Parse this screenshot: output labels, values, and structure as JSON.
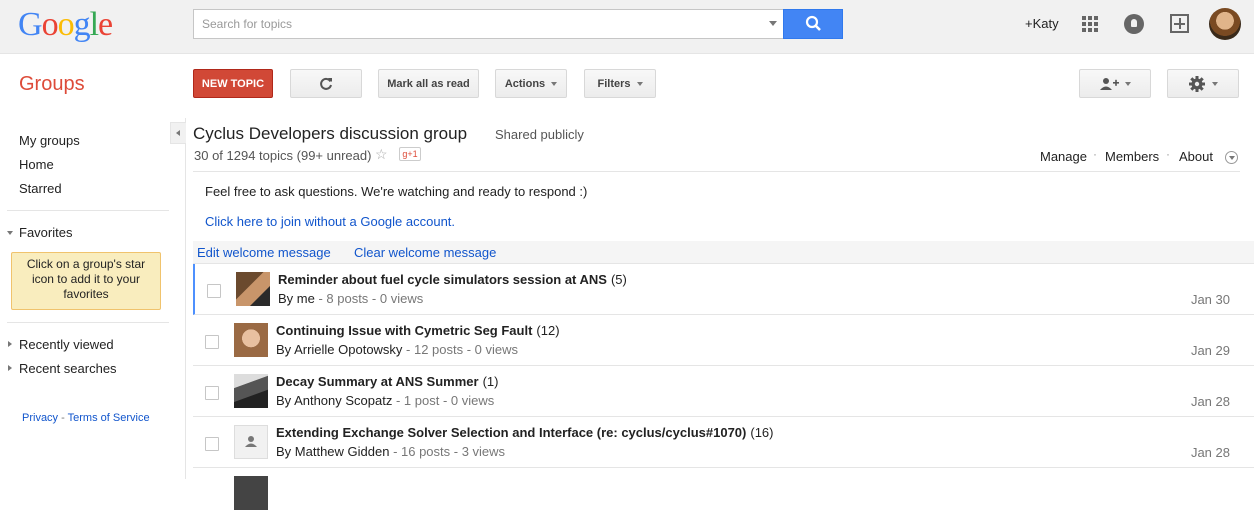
{
  "header": {
    "logo_letters": [
      "G",
      "o",
      "o",
      "g",
      "l",
      "e"
    ],
    "logo_colors": [
      "#4285f4",
      "#ea4335",
      "#fbbc05",
      "#4285f4",
      "#34a853",
      "#ea4335"
    ],
    "search_placeholder": "Search for topics",
    "user_link": "+Katy"
  },
  "toolbar": {
    "app_title": "Groups",
    "new_topic": "NEW TOPIC",
    "mark_all_read": "Mark all as read",
    "actions": "Actions",
    "filters": "Filters"
  },
  "sidebar": {
    "items": [
      "My groups",
      "Home",
      "Starred"
    ],
    "favorites_label": "Favorites",
    "favorites_hint": "Click on a group's star icon to add it to your favorites",
    "recently_viewed": "Recently viewed",
    "recent_searches": "Recent searches",
    "privacy": "Privacy",
    "terms": "Terms of Service"
  },
  "group": {
    "name": "Cyclus Developers discussion group",
    "visibility": "Shared publicly",
    "topic_count": "30 of 1294 topics (99+ unread)",
    "gplus": "g+1",
    "manage": "Manage",
    "members": "Members",
    "about": "About",
    "welcome_text": "Feel free to ask questions.  We're watching and ready to respond :)",
    "join_link": "Click here to join without a Google account.",
    "edit_welcome": "Edit welcome message",
    "clear_welcome": "Clear welcome message"
  },
  "topics": [
    {
      "title": "Reminder about fuel cycle simulators session at ANS",
      "count": "(5)",
      "by": "By me",
      "stats": " - 8 posts - 0 views",
      "date": "Jan 30"
    },
    {
      "title": "Continuing Issue with Cymetric Seg Fault",
      "count": "(12)",
      "by": "By Arrielle Opotowsky",
      "stats": " - 12 posts - 0 views",
      "date": "Jan 29"
    },
    {
      "title": "Decay Summary at ANS Summer",
      "count": "(1)",
      "by": "By Anthony Scopatz",
      "stats": " - 1 post - 0 views",
      "date": "Jan 28"
    },
    {
      "title": "Extending Exchange Solver Selection and Interface (re: cyclus/cyclus#1070)",
      "count": "(16)",
      "by": "By Matthew Gidden",
      "stats": " - 16 posts - 3 views",
      "date": "Jan 28"
    }
  ]
}
